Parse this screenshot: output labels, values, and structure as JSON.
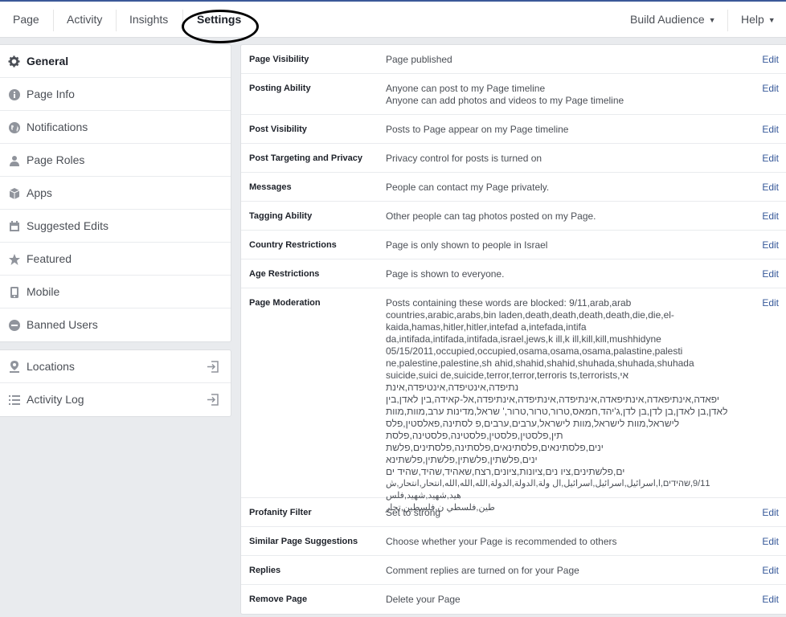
{
  "header": {
    "tabs": [
      {
        "label": "Page"
      },
      {
        "label": "Activity"
      },
      {
        "label": "Insights"
      },
      {
        "label": "Settings"
      }
    ],
    "build_audience": "Build Audience",
    "help": "Help"
  },
  "sidebar": {
    "items": [
      {
        "label": "General",
        "icon": "gear-icon"
      },
      {
        "label": "Page Info",
        "icon": "info-icon"
      },
      {
        "label": "Notifications",
        "icon": "globe-icon"
      },
      {
        "label": "Page Roles",
        "icon": "person-icon"
      },
      {
        "label": "Apps",
        "icon": "box-icon"
      },
      {
        "label": "Suggested Edits",
        "icon": "calendar-icon"
      },
      {
        "label": "Featured",
        "icon": "star-icon"
      },
      {
        "label": "Mobile",
        "icon": "phone-icon"
      },
      {
        "label": "Banned Users",
        "icon": "ban-icon"
      }
    ],
    "secondary": [
      {
        "label": "Locations",
        "icon": "pin-icon"
      },
      {
        "label": "Activity Log",
        "icon": "list-icon"
      }
    ]
  },
  "settings": {
    "edit_label": "Edit",
    "rows": [
      {
        "title": "Page Visibility",
        "lines": [
          "Page published"
        ]
      },
      {
        "title": "Posting Ability",
        "lines": [
          "Anyone can post to my Page timeline",
          "Anyone can add photos and videos to my Page timeline"
        ]
      },
      {
        "title": "Post Visibility",
        "lines": [
          "Posts to Page appear on my Page timeline"
        ]
      },
      {
        "title": "Post Targeting and Privacy",
        "lines": [
          "Privacy control for posts is turned on"
        ]
      },
      {
        "title": "Messages",
        "lines": [
          "People can contact my Page privately."
        ]
      },
      {
        "title": "Tagging Ability",
        "lines": [
          "Other people can tag photos posted on my Page."
        ]
      },
      {
        "title": "Country Restrictions",
        "lines": [
          "Page is only shown to people in Israel"
        ]
      },
      {
        "title": "Age Restrictions",
        "lines": [
          "Page is shown to everyone."
        ]
      },
      {
        "title": "Page Moderation",
        "lines": [
          "Posts containing these words are blocked: 9/11,arab,arab",
          "countries,arabic,arabs,bin laden,death,death,death,death,die,die,el-",
          "kaida,hamas,hitler,hitler,intefad a,intefada,intifa",
          "da,intifada,intifada,intifada,israel,jews,k ill,k ill,kill,kill,mushhidyne",
          "05/15/2011,occupied,occupied,osama,osama,osama,palastine,palesti",
          "ne,palestine,palestine,sh ahid,shahid,shahid,shuhada,shuhada,shuhada",
          "suicide,suici de,suicide,terror,terror,terroris ts,terrorists,אי",
          "נתיפדה,אינטיפדה,אינטיפדה,אינת",
          "יפאדה,אינתיפאדה,אינתיפאדה,אינתיפדה,אינתיפדה,אינתיפדה,אל-קאידה,בין לאדן,בין",
          "לאדן,בן לאדן,בן לדן,בן לדן,ג'יהד,חמאס,טרור,טרור,טרור,' שראל,מדינות ערב,מוות,מוות",
          "לישראל,מוות לישראל,מוות לישראל,ערבים,ערבים,פ לסתינה,פאלסטין,פלס",
          "תין,פלסטין,פלסטין,פלסטינה,פלסטינה,פלסת",
          "ינים,פלסתינאים,פלסתינאים,פלסתינה,פלסתינים,פלשת ינים,פלשתין,פלשתין,פלשתין,פלשתינא",
          "ים,פלשתינים,ציו נים,ציונות,ציונים,רצח,שאהיד,שהיד,שהיד ים",
          "9/11,שהידים,ا,اسرائيل,اسرائيل,اسرائيل,ال ولة,الدولة,الدولة,الله,الله,الله,انتحار,انتحار,ش هيد,شهيد,شهيد,فلس",
          "طين,فلسطي ن,فلسطين,تحار"
        ]
      },
      {
        "title": "Profanity Filter",
        "lines": [
          "Set to strong"
        ]
      },
      {
        "title": "Similar Page Suggestions",
        "lines": [
          "Choose whether your Page is recommended to others"
        ]
      },
      {
        "title": "Replies",
        "lines": [
          "Comment replies are turned on for your Page"
        ]
      },
      {
        "title": "Remove Page",
        "lines": [
          "Delete your Page"
        ]
      }
    ]
  }
}
